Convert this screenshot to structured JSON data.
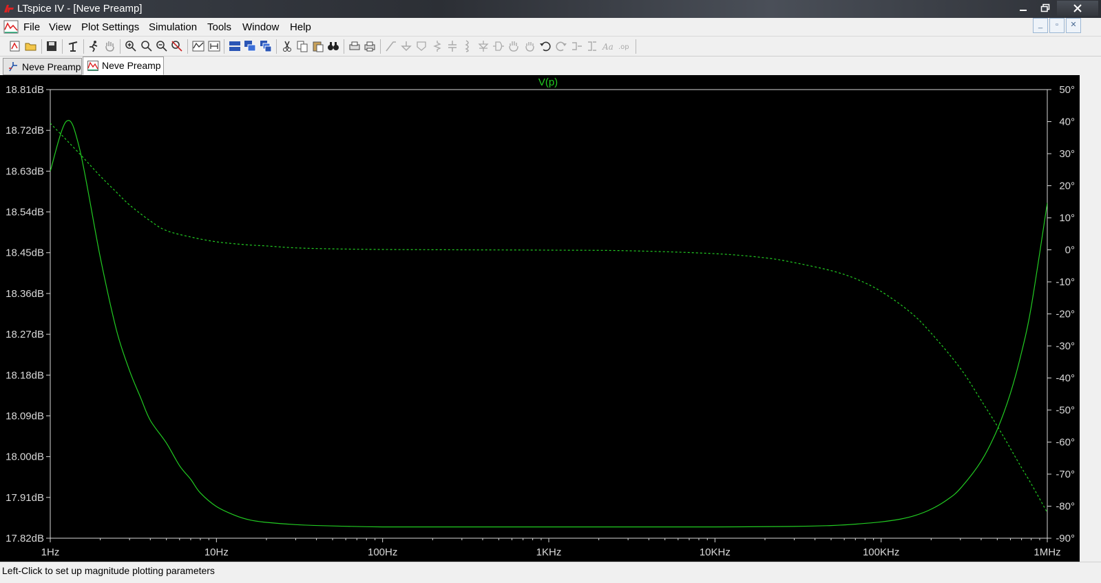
{
  "window": {
    "title": "LTspice IV - [Neve Preamp]"
  },
  "menu": {
    "items": [
      "File",
      "View",
      "Plot Settings",
      "Simulation",
      "Tools",
      "Window",
      "Help"
    ]
  },
  "toolbar": {
    "icons": [
      "new-schematic-icon",
      "open-icon",
      "save-icon",
      "control-panel-icon",
      "run-icon",
      "halt-icon",
      "zoom-in-icon",
      "zoom-area-icon",
      "zoom-out-icon",
      "zoom-cancel-icon",
      "autorange-icon",
      "fit-icon",
      "tile-horizontal-icon",
      "cascade-icon",
      "tile-vertical-icon",
      "cut-icon",
      "copy-icon",
      "paste-icon",
      "find-icon",
      "print-icon",
      "print-preview-icon",
      "wire-icon",
      "ground-icon",
      "label-icon",
      "resistor-icon",
      "capacitor-icon",
      "inductor-icon",
      "diode-icon",
      "component-icon",
      "move-icon",
      "drag-icon",
      "undo-icon",
      "redo-icon",
      "rotate-icon",
      "mirror-icon",
      "text-icon",
      "spice-directive-icon"
    ]
  },
  "tabs": [
    {
      "label": "Neve Preamp",
      "icon": "schematic-icon",
      "active": false
    },
    {
      "label": "Neve Preamp",
      "icon": "waveform-icon",
      "active": true
    }
  ],
  "status": {
    "text": "Left-Click to set up magnitude plotting parameters"
  },
  "colors": {
    "trace": "#22cc22",
    "plot_bg": "#000000",
    "axis": "#d8d8d8"
  },
  "chart_data": {
    "type": "line",
    "title": "V(p)",
    "x_scale": "log",
    "xlim": [
      1,
      1000000
    ],
    "x_ticks": [
      {
        "value": 1,
        "label": "1Hz"
      },
      {
        "value": 10,
        "label": "10Hz"
      },
      {
        "value": 100,
        "label": "100Hz"
      },
      {
        "value": 1000,
        "label": "1KHz"
      },
      {
        "value": 10000,
        "label": "10KHz"
      },
      {
        "value": 100000,
        "label": "100KHz"
      },
      {
        "value": 1000000,
        "label": "1MHz"
      }
    ],
    "ylim": [
      17.82,
      18.81
    ],
    "y_ticks": [
      {
        "value": 18.81,
        "label": "18.81dB"
      },
      {
        "value": 18.72,
        "label": "18.72dB"
      },
      {
        "value": 18.63,
        "label": "18.63dB"
      },
      {
        "value": 18.54,
        "label": "18.54dB"
      },
      {
        "value": 18.45,
        "label": "18.45dB"
      },
      {
        "value": 18.36,
        "label": "18.36dB"
      },
      {
        "value": 18.27,
        "label": "18.27dB"
      },
      {
        "value": 18.18,
        "label": "18.18dB"
      },
      {
        "value": 18.09,
        "label": "18.09dB"
      },
      {
        "value": 18.0,
        "label": "18.00dB"
      },
      {
        "value": 17.91,
        "label": "17.91dB"
      },
      {
        "value": 17.82,
        "label": "17.82dB"
      }
    ],
    "y2lim": [
      -90,
      50
    ],
    "y2_ticks": [
      {
        "value": 50,
        "label": "50°"
      },
      {
        "value": 40,
        "label": "40°"
      },
      {
        "value": 30,
        "label": "30°"
      },
      {
        "value": 20,
        "label": "20°"
      },
      {
        "value": 10,
        "label": "10°"
      },
      {
        "value": 0,
        "label": "0°"
      },
      {
        "value": -10,
        "label": "-10°"
      },
      {
        "value": -20,
        "label": "-20°"
      },
      {
        "value": -30,
        "label": "-30°"
      },
      {
        "value": -40,
        "label": "-40°"
      },
      {
        "value": -50,
        "label": "-50°"
      },
      {
        "value": -60,
        "label": "-60°"
      },
      {
        "value": -70,
        "label": "-70°"
      },
      {
        "value": -80,
        "label": "-80°"
      },
      {
        "value": -90,
        "label": "-90°"
      }
    ],
    "grid": false,
    "series": [
      {
        "axis": "magnitude",
        "style": "solid",
        "x": [
          1,
          1.25,
          1.5,
          2,
          2.5,
          3,
          3.5,
          4,
          5,
          6,
          7,
          8,
          10,
          13,
          16,
          20,
          30,
          50,
          100,
          300,
          1000,
          3000,
          10000,
          30000,
          50000,
          70000,
          100000,
          130000,
          160000,
          200000,
          250000,
          300000,
          400000,
          500000,
          600000,
          700000,
          800000,
          1000000
        ],
        "y": [
          18.63,
          18.74,
          18.68,
          18.44,
          18.28,
          18.19,
          18.13,
          18.08,
          18.03,
          17.98,
          17.95,
          17.92,
          17.89,
          17.87,
          17.86,
          17.855,
          17.85,
          17.847,
          17.845,
          17.845,
          17.845,
          17.845,
          17.845,
          17.846,
          17.848,
          17.851,
          17.856,
          17.862,
          17.87,
          17.884,
          17.905,
          17.93,
          17.99,
          18.06,
          18.14,
          18.23,
          18.33,
          18.56
        ]
      },
      {
        "axis": "phase",
        "style": "dashed",
        "x": [
          1,
          1.5,
          2,
          2.5,
          3,
          4,
          5,
          7,
          10,
          15,
          20,
          30,
          50,
          100,
          300,
          1000,
          3000,
          10000,
          20000,
          30000,
          50000,
          70000,
          100000,
          150000,
          200000,
          300000,
          400000,
          500000,
          600000,
          700000,
          800000,
          1000000
        ],
        "y": [
          39.5,
          30,
          23,
          18,
          14,
          9,
          6,
          4,
          2.5,
          1.6,
          1.2,
          0.6,
          0.3,
          0.1,
          0,
          -0.1,
          -0.3,
          -1.2,
          -2.5,
          -4,
          -6.5,
          -9,
          -13,
          -19.5,
          -26,
          -37,
          -47,
          -55,
          -62,
          -68,
          -73,
          -82
        ]
      }
    ]
  }
}
